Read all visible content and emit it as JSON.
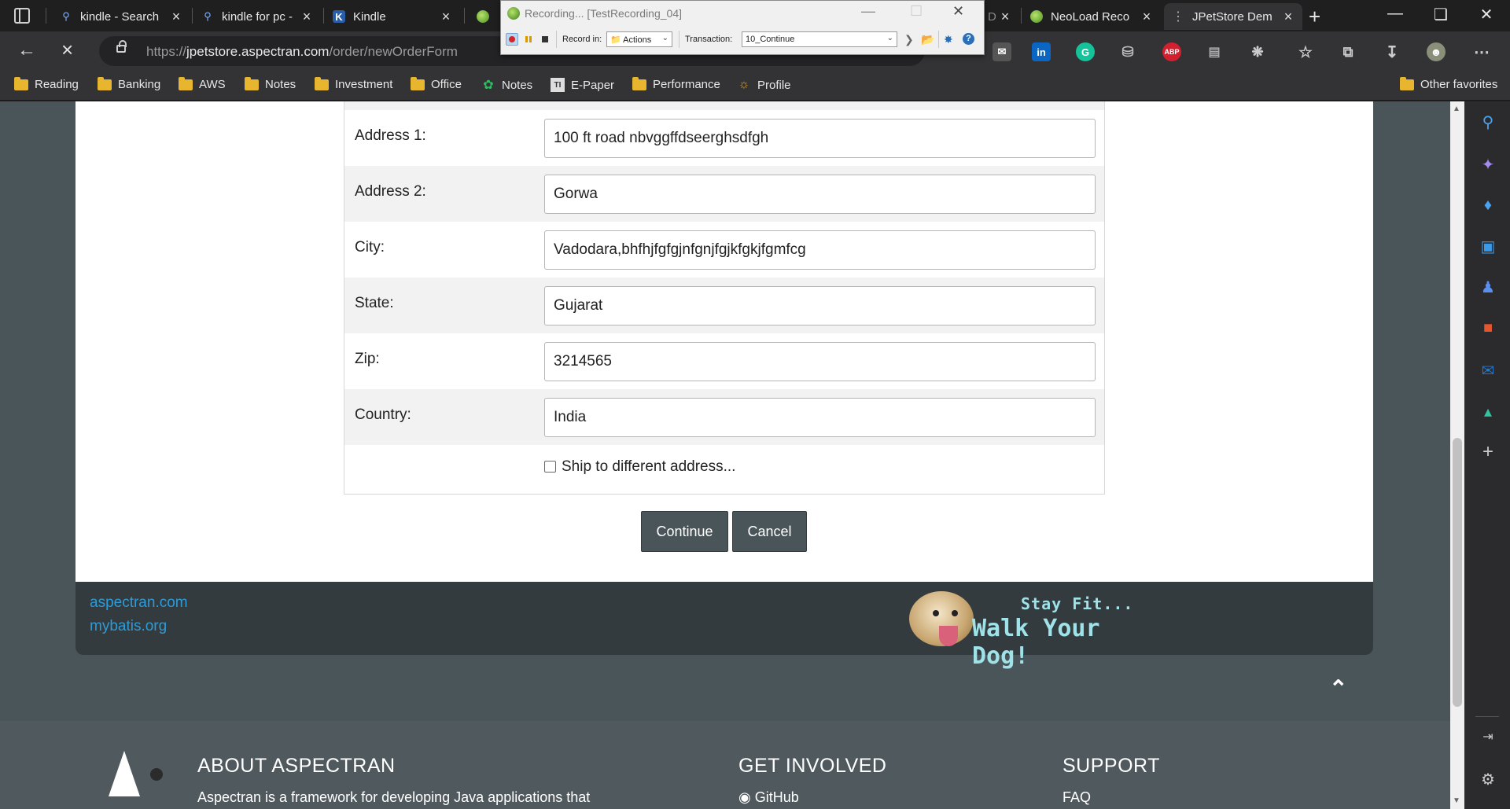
{
  "tabs": [
    {
      "title": "kindle - Search",
      "icon": "search-icon"
    },
    {
      "title": "kindle for pc -",
      "icon": "search-icon"
    },
    {
      "title": "Kindle",
      "icon": "kindle-icon"
    },
    {
      "title": "",
      "icon": "neoload-icon"
    },
    {
      "title": "D",
      "icon": ""
    },
    {
      "title": "NeoLoad Reco",
      "icon": "neoload-icon"
    },
    {
      "title": "JPetStore Dem",
      "icon": "loading-icon"
    }
  ],
  "address_bar": {
    "url_prefix": "https://",
    "url_host": "jpetstore.aspectran.com",
    "url_path": "/order/newOrderForm"
  },
  "bookmarks": [
    {
      "label": "Reading",
      "icon": "folder-icon"
    },
    {
      "label": "Banking",
      "icon": "folder-icon"
    },
    {
      "label": "AWS",
      "icon": "folder-icon"
    },
    {
      "label": "Notes",
      "icon": "folder-icon"
    },
    {
      "label": "Investment",
      "icon": "folder-icon"
    },
    {
      "label": "Office",
      "icon": "folder-icon"
    },
    {
      "label": "Notes",
      "icon": "evernote-icon"
    },
    {
      "label": "E-Paper",
      "icon": "newspaper-icon"
    },
    {
      "label": "Performance",
      "icon": "folder-icon"
    },
    {
      "label": "Profile",
      "icon": "profile-icon"
    },
    {
      "label": "Other favorites",
      "icon": "folder-icon"
    }
  ],
  "recorder": {
    "title": "Recording... [TestRecording_04]",
    "record_in_label": "Record in:",
    "record_in_value": "Actions",
    "transaction_label": "Transaction:",
    "transaction_value": "10_Continue"
  },
  "form": {
    "rows": [
      {
        "label": "Address 1:",
        "value": "100 ft road nbvggffdseerghsdfgh"
      },
      {
        "label": "Address 2:",
        "value": "Gorwa"
      },
      {
        "label": "City:",
        "value": "Vadodara,bhfhjfgfgjnfgnjfgjkfgkjfgmfcg"
      },
      {
        "label": "State:",
        "value": "Gujarat"
      },
      {
        "label": "Zip:",
        "value": "3214565"
      },
      {
        "label": "Country:",
        "value": "India"
      }
    ],
    "ship_label": "Ship to different address...",
    "ship_checked": false,
    "continue_label": "Continue",
    "cancel_label": "Cancel"
  },
  "footer_links": [
    "aspectran.com",
    "mybatis.org"
  ],
  "banner": {
    "line1": "Stay Fit...",
    "line2": "Walk Your Dog!"
  },
  "site_footer": {
    "about_heading": "ABOUT ASPECTRAN",
    "about_text": "Aspectran is a framework for developing Java applications that",
    "involved_heading": "GET INVOLVED",
    "github_label": "GitHub",
    "support_heading": "SUPPORT",
    "faq_label": "FAQ"
  },
  "colors": {
    "accent_link": "#2e9bd6",
    "button_bg": "#4a5559",
    "page_bg": "#4a5559"
  }
}
